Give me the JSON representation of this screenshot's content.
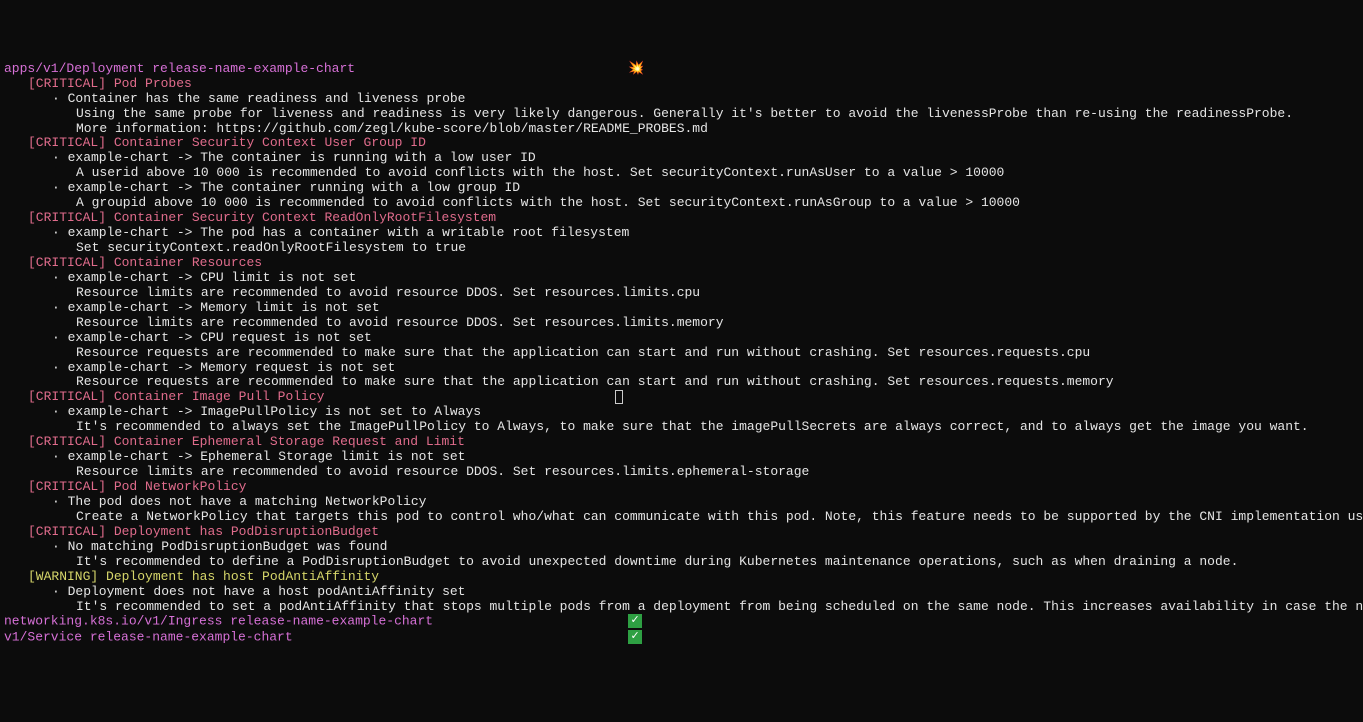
{
  "resources": [
    {
      "header_prefix": "apps/v1/Deployment ",
      "header_name": "release-name-example-chart",
      "status_icon": "💥",
      "checks": [
        {
          "level": "CRITICAL",
          "title": "Pod Probes",
          "level_class": "pink",
          "items": [
            {
              "summary": "Container has the same readiness and liveness probe",
              "details": [
                "Using the same probe for liveness and readiness is very likely dangerous. Generally it's better to avoid the livenessProbe than re-using the readinessProbe.",
                "More information: https://github.com/zegl/kube-score/blob/master/README_PROBES.md"
              ]
            }
          ]
        },
        {
          "level": "CRITICAL",
          "title": "Container Security Context User Group ID",
          "level_class": "pink",
          "items": [
            {
              "summary": "example-chart -> The container is running with a low user ID",
              "details": [
                "A userid above 10 000 is recommended to avoid conflicts with the host. Set securityContext.runAsUser to a value > 10000"
              ]
            },
            {
              "summary": "example-chart -> The container running with a low group ID",
              "details": [
                "A groupid above 10 000 is recommended to avoid conflicts with the host. Set securityContext.runAsGroup to a value > 10000"
              ]
            }
          ]
        },
        {
          "level": "CRITICAL",
          "title": "Container Security Context ReadOnlyRootFilesystem",
          "level_class": "pink",
          "items": [
            {
              "summary": "example-chart -> The pod has a container with a writable root filesystem",
              "details": [
                "Set securityContext.readOnlyRootFilesystem to true"
              ]
            }
          ]
        },
        {
          "level": "CRITICAL",
          "title": "Container Resources",
          "level_class": "pink",
          "items": [
            {
              "summary": "example-chart -> CPU limit is not set",
              "details": [
                "Resource limits are recommended to avoid resource DDOS. Set resources.limits.cpu"
              ]
            },
            {
              "summary": "example-chart -> Memory limit is not set",
              "details": [
                "Resource limits are recommended to avoid resource DDOS. Set resources.limits.memory"
              ]
            },
            {
              "summary": "example-chart -> CPU request is not set",
              "details": [
                "Resource requests are recommended to make sure that the application can start and run without crashing. Set resources.requests.cpu"
              ]
            },
            {
              "summary": "example-chart -> Memory request is not set",
              "details": [
                "Resource requests are recommended to make sure that the application can start and run without crashing. Set resources.requests.memory"
              ]
            }
          ]
        },
        {
          "level": "CRITICAL",
          "title": "Container Image Pull Policy",
          "level_class": "pink",
          "has_cursor": true,
          "items": [
            {
              "summary": "example-chart -> ImagePullPolicy is not set to Always",
              "details": [
                "It's recommended to always set the ImagePullPolicy to Always, to make sure that the imagePullSecrets are always correct, and to always get the image you want."
              ]
            }
          ]
        },
        {
          "level": "CRITICAL",
          "title": "Container Ephemeral Storage Request and Limit",
          "level_class": "pink",
          "items": [
            {
              "summary": "example-chart -> Ephemeral Storage limit is not set",
              "details": [
                "Resource limits are recommended to avoid resource DDOS. Set resources.limits.ephemeral-storage"
              ]
            }
          ]
        },
        {
          "level": "CRITICAL",
          "title": "Pod NetworkPolicy",
          "level_class": "pink",
          "items": [
            {
              "summary": "The pod does not have a matching NetworkPolicy",
              "details": [
                "Create a NetworkPolicy that targets this pod to control who/what can communicate with this pod. Note, this feature needs to be supported by the CNI implementation used in the Kubernetes cluster to have an effect."
              ]
            }
          ]
        },
        {
          "level": "CRITICAL",
          "title": "Deployment has PodDisruptionBudget",
          "level_class": "pink",
          "items": [
            {
              "summary": "No matching PodDisruptionBudget was found",
              "details": [
                "It's recommended to define a PodDisruptionBudget to avoid unexpected downtime during Kubernetes maintenance operations, such as when draining a node."
              ]
            }
          ]
        },
        {
          "level": "WARNING",
          "title": "Deployment has host PodAntiAffinity",
          "level_class": "yellow",
          "items": [
            {
              "summary": "Deployment does not have a host podAntiAffinity set",
              "details": [
                "It's recommended to set a podAntiAffinity that stops multiple pods from a deployment from being scheduled on the same node. This increases availability in case the node becomes unavailable."
              ]
            }
          ]
        }
      ]
    },
    {
      "header_prefix": "networking.k8s.io/v1/Ingress ",
      "header_name": "release-name-example-chart",
      "status_icon": "✅",
      "checks": []
    },
    {
      "header_prefix": "v1/Service ",
      "header_name": "release-name-example-chart",
      "status_icon": "✅",
      "checks": []
    }
  ]
}
